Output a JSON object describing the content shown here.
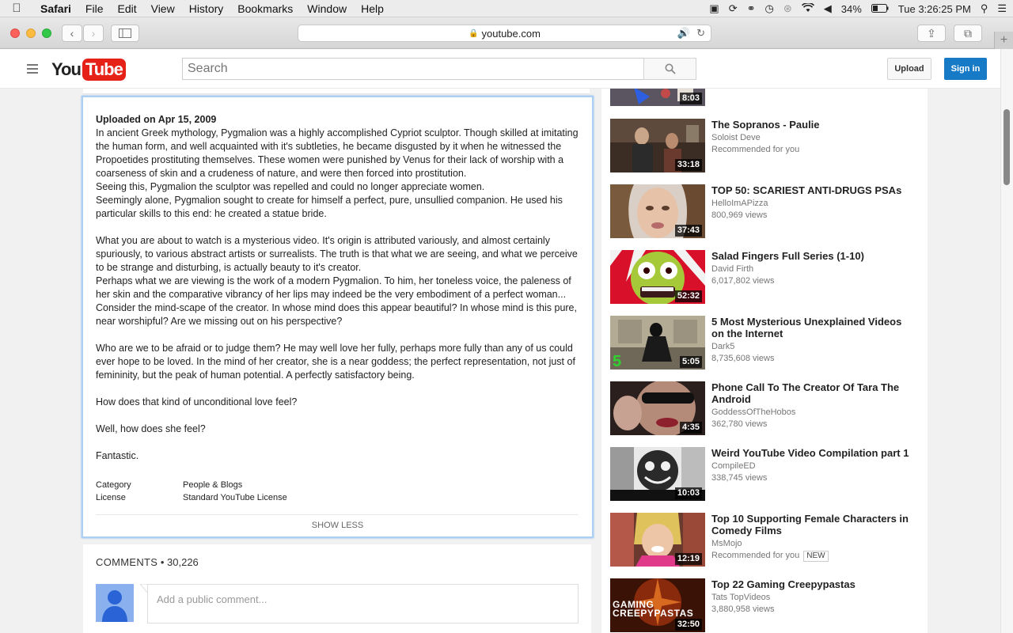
{
  "menubar": {
    "app": "Safari",
    "items": [
      "File",
      "Edit",
      "View",
      "History",
      "Bookmarks",
      "Window",
      "Help"
    ],
    "battery": "34%",
    "clock": "Tue 3:26:25 PM"
  },
  "browser": {
    "url": "youtube.com"
  },
  "header": {
    "logo_you": "You",
    "logo_tube": "Tube",
    "search_placeholder": "Search",
    "upload_label": "Upload",
    "signin_label": "Sign in"
  },
  "description": {
    "upload_date": "Uploaded on Apr 15, 2009",
    "p1": "In ancient Greek mythology, Pygmalion was a highly accomplished Cypriot sculptor. Though skilled at imitating the human form, and well acquainted with it's subtleties, he became disgusted by it when he witnessed the Propoetides prostituting themselves. These women were punished by Venus for their lack of worship with a coarseness of skin and a crudeness of nature, and were then forced into prostitution.",
    "p2": "Seeing this, Pygmalion the sculptor was repelled and could no longer appreciate women.",
    "p3": "Seemingly alone, Pygmalion sought to create for himself a perfect, pure, unsullied companion. He used his particular skills to this end: he created a statue bride.",
    "p4": "What you are about to watch is a mysterious video. It's origin is attributed variously, and almost certainly spuriously, to various abstract artists or surrealists. The truth is that what we are seeing, and what we perceive to be strange and disturbing, is actually beauty to it's creator.",
    "p5": "Perhaps what we are viewing is the work of a modern Pygmalion. To him, her toneless voice, the paleness of her skin and the comparative vibrancy of her lips may indeed be the very embodiment of a perfect woman...",
    "p6": "Consider the mind-scape of the creator. In whose mind does this appear beautiful? In whose mind is this pure, near worshipful? Are we missing out on his perspective?",
    "p7": "Who are we to be afraid or to judge them? He may well love her fully, perhaps more fully than any of us could ever hope to be loved. In the mind of her creator, she is a near goddess; the perfect representation, not just of femininity, but the peak of human potential. A perfectly satisfactory being.",
    "p8": "How does that kind of unconditional love feel?",
    "p9": "Well, how does she feel?",
    "p10": "Fantastic.",
    "category_label": "Category",
    "category_value": "People & Blogs",
    "license_label": "License",
    "license_value": "Standard YouTube License",
    "show_less": "SHOW LESS"
  },
  "comments": {
    "label": "COMMENTS",
    "separator": " • ",
    "count": "30,226",
    "placeholder": "Add a public comment..."
  },
  "sidebar": {
    "partial_duration": "8:03",
    "videos": [
      {
        "title": "The Sopranos - Paulie",
        "channel": "Soloist Deve",
        "stat": "Recommended for you",
        "duration": "33:18",
        "badge": ""
      },
      {
        "title": "TOP 50: SCARIEST ANTI-DRUGS PSAs",
        "channel": "HelloImAPizza",
        "stat": "800,969 views",
        "duration": "37:43",
        "badge": ""
      },
      {
        "title": "Salad Fingers Full Series (1-10)",
        "channel": "David Firth",
        "stat": "6,017,802 views",
        "duration": "52:32",
        "badge": ""
      },
      {
        "title": "5 Most Mysterious Unexplained Videos on the Internet",
        "channel": "Dark5",
        "stat": "8,735,608 views",
        "duration": "5:05",
        "badge": ""
      },
      {
        "title": "Phone Call To The Creator Of Tara The Android",
        "channel": "GoddessOfTheHobos",
        "stat": "362,780 views",
        "duration": "4:35",
        "badge": ""
      },
      {
        "title": "Weird YouTube Video Compilation part 1",
        "channel": "CompileED",
        "stat": "338,745 views",
        "duration": "10:03",
        "badge": ""
      },
      {
        "title": "Top 10 Supporting Female Characters in Comedy Films",
        "channel": "MsMojo",
        "stat": "Recommended for you",
        "duration": "12:19",
        "badge": "NEW"
      },
      {
        "title": "Top 22 Gaming Creepypastas",
        "channel": "Tats TopVideos",
        "stat": "3,880,958 views",
        "duration": "32:50",
        "badge": "",
        "thumb_text": "GAMING CREEPYPASTAS"
      }
    ]
  }
}
